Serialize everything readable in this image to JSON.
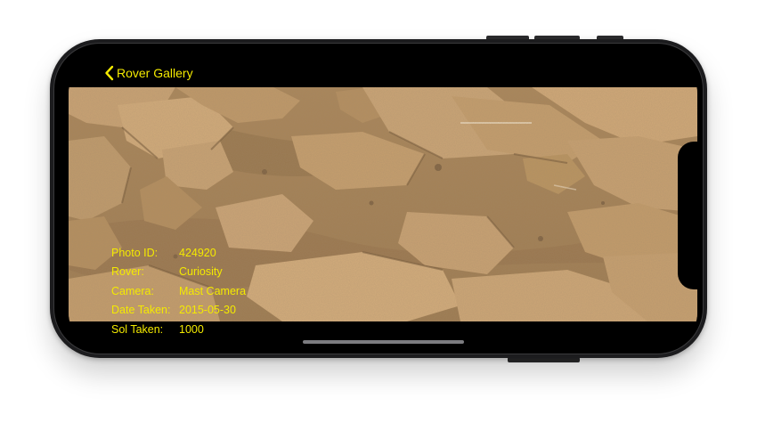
{
  "nav": {
    "back_label": "Rover Gallery",
    "back_icon": "chevron-left-icon",
    "accent_color": "#f4ea00"
  },
  "photo": {
    "alt": "Martian rocky terrain",
    "details": [
      {
        "label": "Photo ID:",
        "value": "424920"
      },
      {
        "label": "Rover:",
        "value": "Curiosity"
      },
      {
        "label": "Camera:",
        "value": "Mast Camera"
      },
      {
        "label": "Date Taken:",
        "value": "2015-05-30"
      },
      {
        "label": "Sol Taken:",
        "value": "1000"
      }
    ]
  }
}
